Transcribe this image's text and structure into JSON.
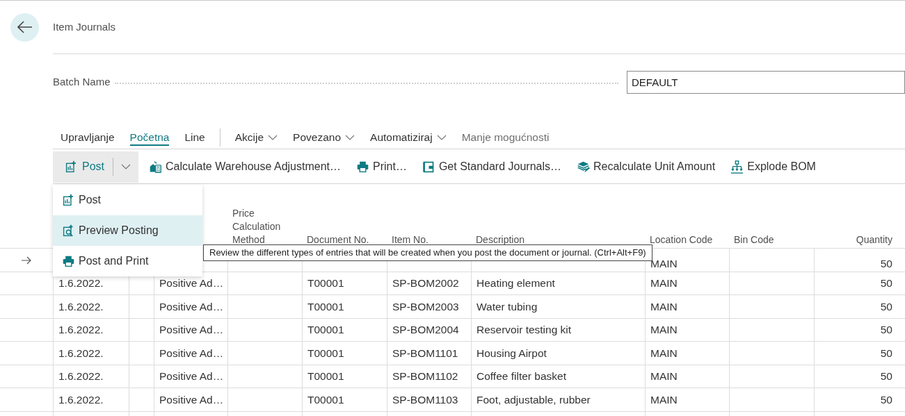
{
  "page": {
    "title": "Item Journals"
  },
  "batch_name": {
    "label": "Batch Name",
    "value": "DEFAULT"
  },
  "action_tabs": [
    {
      "label": "Upravljanje",
      "kind": "tab",
      "selected": false
    },
    {
      "label": "Početna",
      "kind": "tab",
      "selected": true
    },
    {
      "label": "Line",
      "kind": "tab",
      "selected": false
    },
    {
      "label": "Akcije",
      "kind": "menu",
      "selected": false
    },
    {
      "label": "Povezano",
      "kind": "menu",
      "selected": false
    },
    {
      "label": "Automatiziraj",
      "kind": "menu",
      "selected": false
    },
    {
      "label": "Manje mogućnosti",
      "kind": "toggle",
      "selected": false
    }
  ],
  "toolbar": [
    {
      "label": "Post",
      "kind": "split"
    },
    {
      "label": "Calculate Warehouse Adjustment…",
      "kind": "action"
    },
    {
      "label": "Print…",
      "kind": "action"
    },
    {
      "label": "Get Standard Journals…",
      "kind": "action"
    },
    {
      "label": "Recalculate Unit Amount",
      "kind": "action"
    },
    {
      "label": "Explode BOM",
      "kind": "action"
    }
  ],
  "post_menu": {
    "expanded": true,
    "items": [
      {
        "label": "Post",
        "selected": false
      },
      {
        "label": "Preview Posting",
        "selected": true
      },
      {
        "label": "Post and Print",
        "selected": false
      }
    ]
  },
  "tooltip": "Review the different types of entries that will be created when you post the document or journal. (Ctrl+Alt+F9)",
  "table": {
    "columns": {
      "price_calculation_method": "Price Calculation Method",
      "document_no": "Document No.",
      "item_no": "Item No.",
      "description": "Description",
      "location_code": "Location Code",
      "bin_code": "Bin Code",
      "quantity": "Quantity"
    },
    "rows": [
      {
        "current": true,
        "cells": {
          "location_code": "MAIN",
          "quantity": "50"
        }
      },
      {
        "current": false,
        "cells": {
          "column_1": "1.6.2022.",
          "column_3": "Positive Ad…",
          "document_no": "T00001",
          "item_no": "SP-BOM2002",
          "description": "Heating element",
          "location_code": "MAIN",
          "quantity": "50"
        }
      },
      {
        "current": false,
        "cells": {
          "column_1": "1.6.2022.",
          "column_3": "Positive Ad…",
          "document_no": "T00001",
          "item_no": "SP-BOM2003",
          "description": "Water tubing",
          "location_code": "MAIN",
          "quantity": "50"
        }
      },
      {
        "current": false,
        "cells": {
          "column_1": "1.6.2022.",
          "column_3": "Positive Ad…",
          "document_no": "T00001",
          "item_no": "SP-BOM2004",
          "description": "Reservoir testing kit",
          "location_code": "MAIN",
          "quantity": "50"
        }
      },
      {
        "current": false,
        "cells": {
          "column_1": "1.6.2022.",
          "column_3": "Positive Ad…",
          "document_no": "T00001",
          "item_no": "SP-BOM1101",
          "description": "Housing Airpot",
          "location_code": "MAIN",
          "quantity": "50"
        }
      },
      {
        "current": false,
        "cells": {
          "column_1": "1.6.2022.",
          "column_3": "Positive Ad…",
          "document_no": "T00001",
          "item_no": "SP-BOM1102",
          "description": "Coffee filter basket",
          "location_code": "MAIN",
          "quantity": "50"
        }
      },
      {
        "current": false,
        "cells": {
          "column_1": "1.6.2022.",
          "column_3": "Positive Ad…",
          "document_no": "T00001",
          "item_no": "SP-BOM1103",
          "description": "Foot, adjustable, rubber",
          "location_code": "MAIN",
          "quantity": "50"
        }
      }
    ]
  }
}
